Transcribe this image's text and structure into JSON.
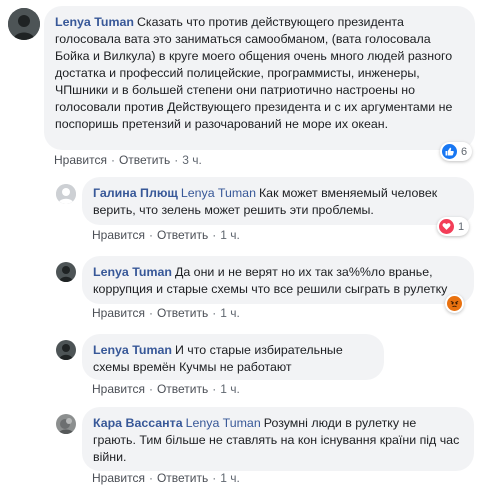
{
  "comments": [
    {
      "author": "Lenya Tuman",
      "mention": "",
      "text": "Сказать что против действующего президента голосовала вата это заниматься самообманом, (вата голосовала Бойка и Вилкула) в круге моего общения очень много людей разного достатка и профессий полицейские, программисты, инженеры, ЧПшники и в большей степени они патриотично настроены но голосовали против Действующего президента и с их аргументами не поспоришь претензий и разочарований не море их океан.",
      "like": "Нравится",
      "reply": "Ответить",
      "time": "3 ч.",
      "reaction_icon": "like-icon",
      "reaction_count": "6"
    },
    {
      "author": "Галина Плющ",
      "mention": "Lenya Tuman",
      "text": "Как может вменяемый человек верить, что зелень может решить эти проблемы.",
      "like": "Нравится",
      "reply": "Ответить",
      "time": "1 ч.",
      "reaction_icon": "love-icon",
      "reaction_count": "1"
    },
    {
      "author": "Lenya Tuman",
      "mention": "",
      "text": "Да они и не верят но их так за%%ло вранье, коррупция и старые схемы что все решили сыграть в рулетку",
      "like": "Нравится",
      "reply": "Ответить",
      "time": "1 ч.",
      "reaction_icon": "angry-icon",
      "reaction_count": ""
    },
    {
      "author": "Lenya Tuman",
      "mention": "",
      "text": "И что старые избирательные схемы времён Кучмы не работают",
      "like": "Нравится",
      "reply": "Ответить",
      "time": "1 ч.",
      "reaction_icon": "",
      "reaction_count": ""
    },
    {
      "author": "Кара Вассанта",
      "mention": "Lenya Tuman",
      "text": "Розумні люди в рулетку не грають. Тим більше не ставлять на кон існування країни під час війни.",
      "like": "Нравится",
      "reply": "Ответить",
      "time": "1 ч.",
      "reaction_icon": "",
      "reaction_count": ""
    }
  ],
  "colors": {
    "link": "#385898",
    "bubble": "#f2f3f5",
    "like_blue": "#1877f2",
    "love_red": "#f33e58",
    "angry_orange": "#e9710f"
  }
}
